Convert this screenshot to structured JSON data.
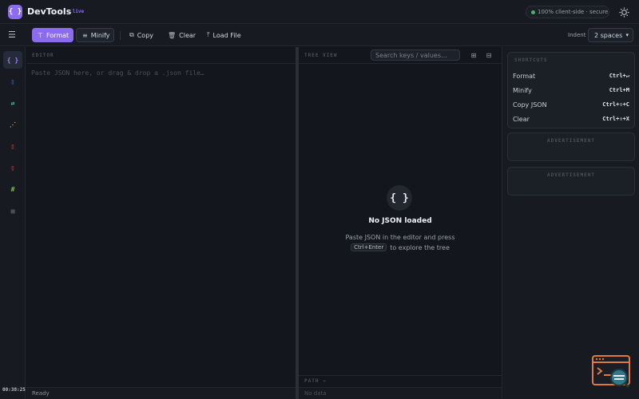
{
  "header": {
    "logo_glyph": "{ }",
    "title": "DevTools",
    "tld": ".live",
    "secure_text": "100% client-side · secure",
    "accent_color": "#8b6cf0",
    "status_color": "#3fb46a"
  },
  "toolbar": {
    "format_label": "Format",
    "minify_label": "Minify",
    "copy_label": "Copy",
    "clear_label": "Clear",
    "load_label": "Load File",
    "indent_label": "Indent",
    "indent_value": "2 spaces"
  },
  "rail": {
    "items": [
      {
        "glyph": "{ }",
        "icon": "json-icon",
        "color": "#9f86f5"
      },
      {
        "glyph": "▯",
        "icon": "device-icon",
        "color": "#4f7cf0"
      },
      {
        "glyph": "⇄",
        "icon": "diff-icon",
        "color": "#3fb4a0"
      },
      {
        "glyph": "⋰",
        "icon": "transform-icon",
        "color": "#d4a23a"
      },
      {
        "glyph": "▯",
        "icon": "document-icon",
        "color": "#d9534f"
      },
      {
        "glyph": "▯",
        "icon": "file-icon",
        "color": "#d9534f"
      },
      {
        "glyph": "#",
        "icon": "hash-icon",
        "color": "#7cc043"
      },
      {
        "glyph": "▦",
        "icon": "grid-icon",
        "color": "#5a606a"
      }
    ],
    "clock": "00:38:25"
  },
  "editor": {
    "title": "EDITOR",
    "placeholder": "Paste JSON here, or drag & drop a .json file…",
    "status": "Ready"
  },
  "tree": {
    "title": "TREE VIEW",
    "search_placeholder": "Search keys / values…",
    "empty_icon": "{ }",
    "empty_title": "No JSON loaded",
    "empty_desc": "Paste JSON in the editor and press",
    "empty_kbd": "Ctrl+Enter",
    "empty_desc_end": "to explore the tree",
    "path_label": "PATH →",
    "path_text": "No data"
  },
  "shortcuts": {
    "title": "SHORTCUTS",
    "items": [
      {
        "label": "Format",
        "key": "Ctrl+↵"
      },
      {
        "label": "Minify",
        "key": "Ctrl+M"
      },
      {
        "label": "Copy JSON",
        "key": "Ctrl+⇧+C"
      },
      {
        "label": "Clear",
        "key": "Ctrl+⇧+X"
      }
    ]
  },
  "ads": {
    "label_1": "ADVERTISEMENT",
    "label_2": "ADVERTISEMENT"
  }
}
